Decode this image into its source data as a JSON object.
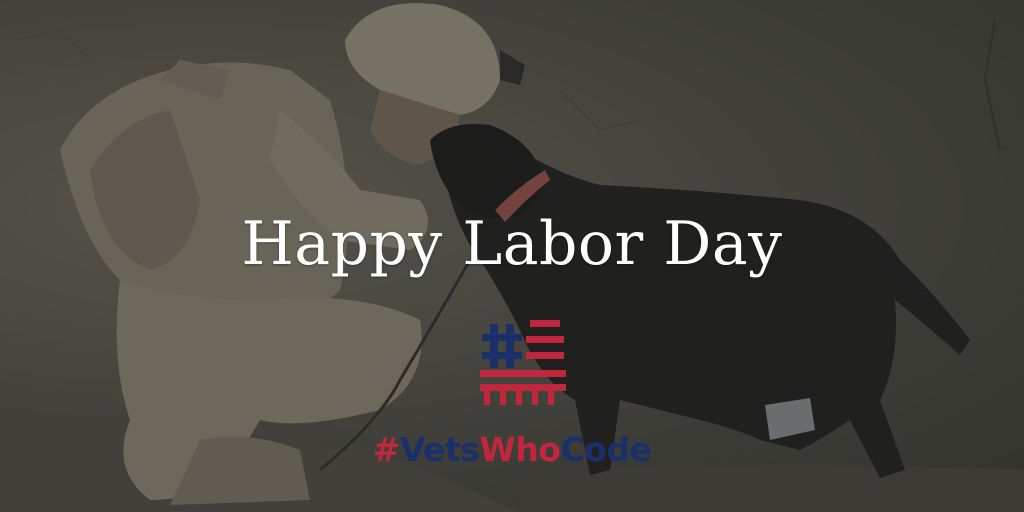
{
  "headline": "Happy Labor Day",
  "brand": {
    "hash": "#",
    "vets": "Vets",
    "who": "Who",
    "code": "Code"
  },
  "colors": {
    "navy": "#1b2f6b",
    "red": "#c0263c",
    "headline_text": "#ffffff"
  },
  "photo": {
    "description_icon": "soldier-with-dog-photo-icon"
  }
}
